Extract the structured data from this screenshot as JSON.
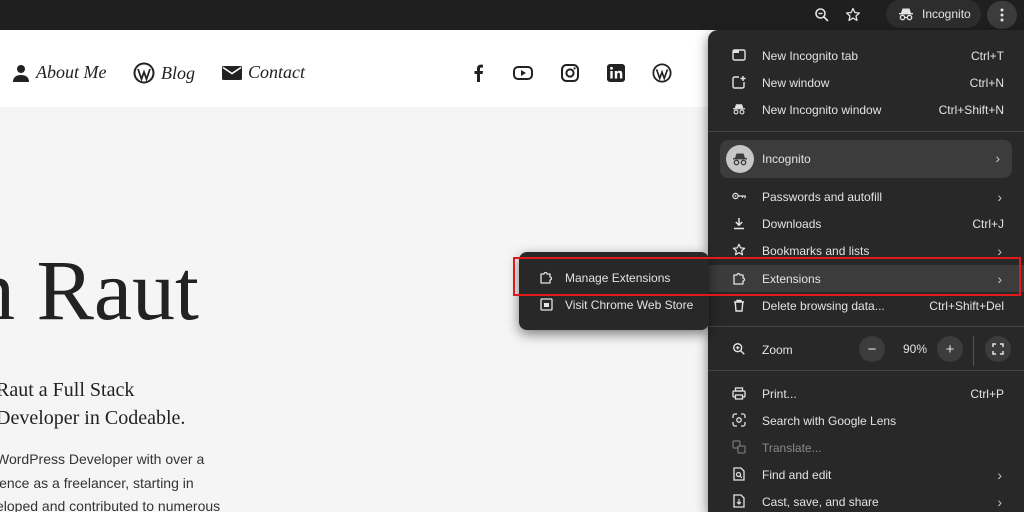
{
  "browser": {
    "profile_label": "Incognito",
    "toolbar_icons": [
      "zoom-icon",
      "star-icon"
    ]
  },
  "site": {
    "nav": [
      {
        "label": "About Me",
        "icon": "person-icon"
      },
      {
        "label": "Blog",
        "icon": "wordpress-icon"
      },
      {
        "label": "Contact",
        "icon": "mail-icon"
      }
    ],
    "social": [
      "facebook-icon",
      "youtube-icon",
      "instagram-icon",
      "linkedin-icon",
      "wordpress-icon"
    ],
    "hero": {
      "name": "n Raut",
      "subtitle_line1": "Raut a Full Stack",
      "subtitle_line2": "Developer in Codeable.",
      "body_line1": "WordPress Developer with over a",
      "body_line2": "ience as a freelancer, starting in",
      "body_line3": "eloped and contributed to numerous"
    }
  },
  "menu": {
    "items": [
      {
        "label": "New Incognito tab",
        "shortcut": "Ctrl+T",
        "icon": "new-tab-icon"
      },
      {
        "label": "New window",
        "shortcut": "Ctrl+N",
        "icon": "new-window-icon"
      },
      {
        "label": "New Incognito window",
        "shortcut": "Ctrl+Shift+N",
        "icon": "incognito-icon"
      },
      {
        "label": "Passwords and autofill",
        "icon": "key-icon"
      },
      {
        "label": "Downloads",
        "shortcut": "Ctrl+J",
        "icon": "download-icon"
      },
      {
        "label": "Bookmarks and lists",
        "icon": "star-icon"
      },
      {
        "label": "Extensions",
        "icon": "puzzle-icon"
      },
      {
        "label": "Delete browsing data...",
        "shortcut": "Ctrl+Shift+Del",
        "icon": "trash-icon"
      },
      {
        "label": "Print...",
        "shortcut": "Ctrl+P",
        "icon": "print-icon"
      },
      {
        "label": "Search with Google Lens",
        "icon": "lens-icon"
      },
      {
        "label": "Translate...",
        "icon": "translate-icon"
      },
      {
        "label": "Find and edit",
        "icon": "find-icon"
      },
      {
        "label": "Cast, save, and share",
        "icon": "cast-icon"
      }
    ],
    "profile": {
      "label": "Incognito"
    },
    "zoom": {
      "label": "Zoom",
      "minus": "−",
      "value": "90%",
      "plus": "+"
    }
  },
  "submenu": {
    "items": [
      {
        "label": "Manage Extensions",
        "icon": "puzzle-icon"
      },
      {
        "label": "Visit Chrome Web Store",
        "icon": "web-store-icon"
      }
    ]
  },
  "colors": {
    "menu_bg": "#282828",
    "highlight_border": "#e0191b",
    "topbar_bg": "#1f1f1f"
  }
}
